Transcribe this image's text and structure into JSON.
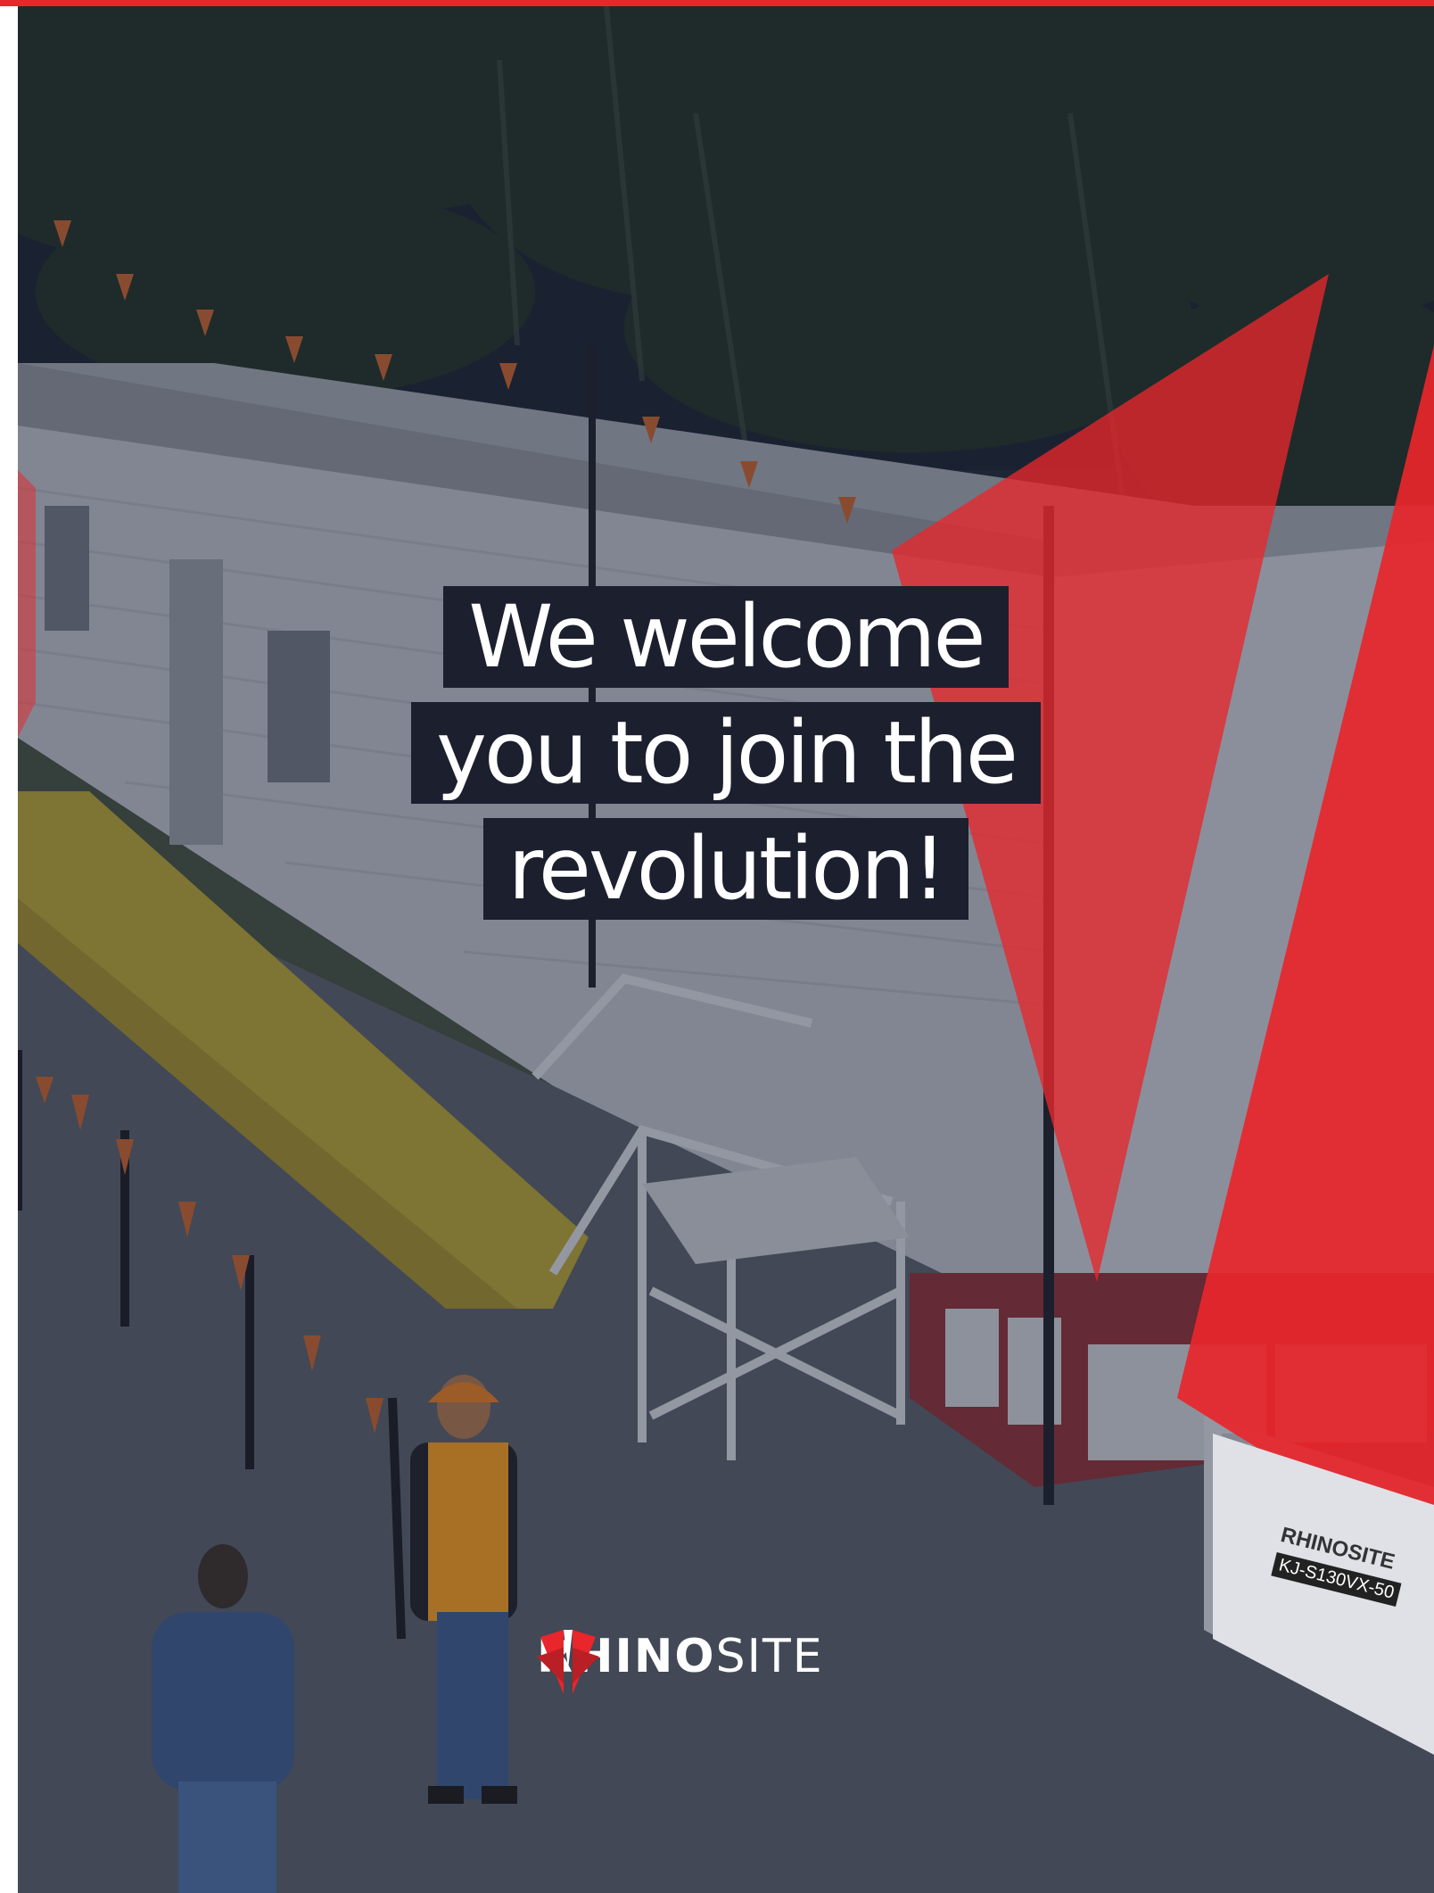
{
  "headline": {
    "lines": [
      "We welcome",
      "you to join the",
      "revolution!"
    ]
  },
  "brand": {
    "name_bold": "RHINO",
    "name_light": "SITE"
  },
  "generator_label": {
    "brand": "RHINOSITE",
    "model": "KJ-S130VX-50"
  },
  "colors": {
    "accent": "#e8262b",
    "overlay": "#1c1f2e"
  },
  "icons": [
    "rhinosite-logo-icon"
  ]
}
